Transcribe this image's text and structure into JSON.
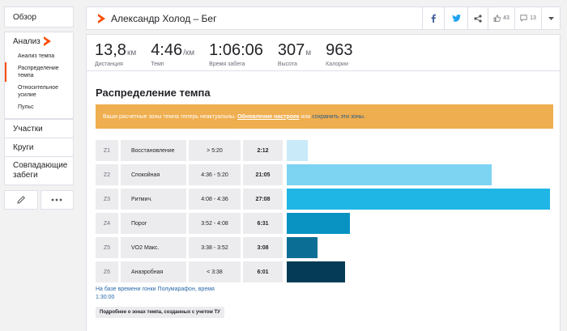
{
  "sidebar": {
    "overview": "Обзор",
    "analysis": "Анализ",
    "sub_items": [
      "Анализ темпа",
      "Распределение темпа",
      "Относительное усилие",
      "Пульс"
    ],
    "segments": "Участки",
    "laps": "Круги",
    "matched": "Совпадающие забеги"
  },
  "header": {
    "title": "Александр Холод – Бег",
    "kudos_count": "43",
    "comment_count": "13"
  },
  "stats": [
    {
      "value": "13,8",
      "unit": "км",
      "label": "Дистанция"
    },
    {
      "value": "4:46",
      "unit": "/км",
      "label": "Темп"
    },
    {
      "value": "1:06:06",
      "unit": "",
      "label": "Время забега"
    },
    {
      "value": "307",
      "unit": "м",
      "label": "Высота"
    },
    {
      "value": "963",
      "unit": "",
      "label": "Калории"
    }
  ],
  "section_title": "Распределение темпа",
  "banner": {
    "text_before": "Ваши расчетные зоны темпа теперь неактуальны.",
    "link_update": "Обновление настроек",
    "text_or": "или",
    "link_keep": "сохранить эти зоны."
  },
  "zones": [
    {
      "id": "Z1",
      "name": "Восстановление",
      "range": "> 5:20",
      "time": "2:12",
      "fraction": 0.0815,
      "color": "#c9eaf8"
    },
    {
      "id": "Z2",
      "name": "Спокойная",
      "range": "4:36 - 5:20",
      "time": "21:05",
      "fraction": 0.778,
      "color": "#7dd3f2"
    },
    {
      "id": "Z3",
      "name": "Ритмич.",
      "range": "4:08 - 4:36",
      "time": "27:08",
      "fraction": 1.0,
      "color": "#1fb6e6"
    },
    {
      "id": "Z4",
      "name": "Порог",
      "range": "3:52 - 4:08",
      "time": "6:31",
      "fraction": 0.24,
      "color": "#0893c3"
    },
    {
      "id": "Z5",
      "name": "VO2 Макс.",
      "range": "3:38 - 3:52",
      "time": "3:08",
      "fraction": 0.1155,
      "color": "#0a6e95"
    },
    {
      "id": "Z6",
      "name": "Анаэробная",
      "range": "< 3:38",
      "time": "6:01",
      "fraction": 0.222,
      "color": "#053b56"
    }
  ],
  "footnote": {
    "line1": "На базе времени гонки Полумарафон, время",
    "line2": "1:30:00"
  },
  "more_button": "Подробнее о зонах темпа, созданных с учетом ТУ",
  "colors": {
    "brand": "#fc4c02",
    "banner": "#efae4f",
    "link": "#2a6aa8"
  }
}
